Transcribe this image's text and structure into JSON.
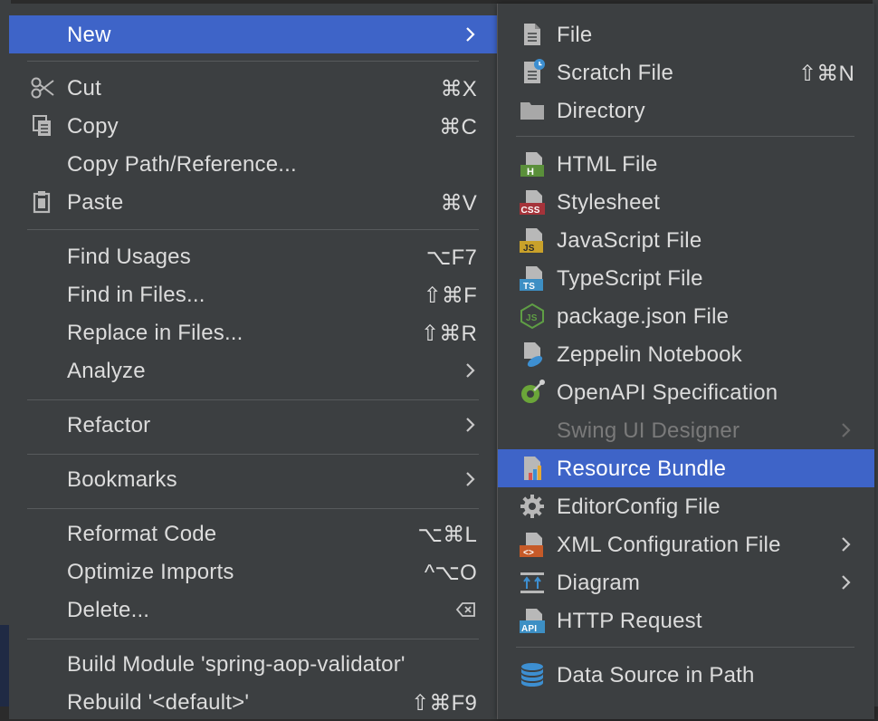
{
  "main_menu": {
    "new": {
      "label": "New"
    },
    "cut": {
      "label": "Cut",
      "shortcut": "⌘X"
    },
    "copy": {
      "label": "Copy",
      "shortcut": "⌘C"
    },
    "copy_path": {
      "label": "Copy Path/Reference..."
    },
    "paste": {
      "label": "Paste",
      "shortcut": "⌘V"
    },
    "find_usages": {
      "label": "Find Usages",
      "shortcut": "⌥F7"
    },
    "find_in_files": {
      "label": "Find in Files...",
      "shortcut": "⇧⌘F"
    },
    "replace_in_files": {
      "label": "Replace in Files...",
      "shortcut": "⇧⌘R"
    },
    "analyze": {
      "label": "Analyze"
    },
    "refactor": {
      "label": "Refactor"
    },
    "bookmarks": {
      "label": "Bookmarks"
    },
    "reformat_code": {
      "label": "Reformat Code",
      "shortcut": "⌥⌘L"
    },
    "optimize_imports": {
      "label": "Optimize Imports",
      "shortcut": "^⌥O"
    },
    "delete": {
      "label": "Delete..."
    },
    "build_module": {
      "label": "Build Module 'spring-aop-validator'"
    },
    "rebuild": {
      "label": "Rebuild '<default>'",
      "shortcut": "⇧⌘F9"
    }
  },
  "new_submenu": {
    "file": {
      "label": "File",
      "icon": "file-icon"
    },
    "scratch_file": {
      "label": "Scratch File",
      "shortcut": "⇧⌘N",
      "icon": "scratch-file-icon"
    },
    "directory": {
      "label": "Directory",
      "icon": "folder-icon"
    },
    "html_file": {
      "label": "HTML File",
      "icon": "html-file-icon",
      "badge": "H"
    },
    "stylesheet": {
      "label": "Stylesheet",
      "icon": "css-file-icon",
      "badge": "CSS"
    },
    "javascript_file": {
      "label": "JavaScript File",
      "icon": "js-file-icon",
      "badge": "JS"
    },
    "typescript_file": {
      "label": "TypeScript File",
      "icon": "ts-file-icon",
      "badge": "TS"
    },
    "package_json": {
      "label": "package.json File",
      "icon": "nodejs-icon"
    },
    "zeppelin": {
      "label": "Zeppelin Notebook",
      "icon": "zeppelin-icon"
    },
    "openapi": {
      "label": "OpenAPI Specification",
      "icon": "openapi-icon"
    },
    "swing_ui": {
      "label": "Swing UI Designer"
    },
    "resource_bundle": {
      "label": "Resource Bundle",
      "icon": "resource-bundle-icon"
    },
    "editorconfig": {
      "label": "EditorConfig File",
      "icon": "gear-icon"
    },
    "xml_config": {
      "label": "XML Configuration File",
      "icon": "xml-file-icon",
      "badge": "<>"
    },
    "diagram": {
      "label": "Diagram",
      "icon": "diagram-icon"
    },
    "http_request": {
      "label": "HTTP Request",
      "icon": "api-file-icon",
      "badge": "API"
    },
    "data_source": {
      "label": "Data Source in Path",
      "icon": "database-icon"
    }
  },
  "colors": {
    "menu_bg": "#3c3f41",
    "selection": "#3e64c8",
    "text": "#dcdcdc",
    "disabled_text": "#7a7a7a",
    "separator": "#575a5c"
  }
}
